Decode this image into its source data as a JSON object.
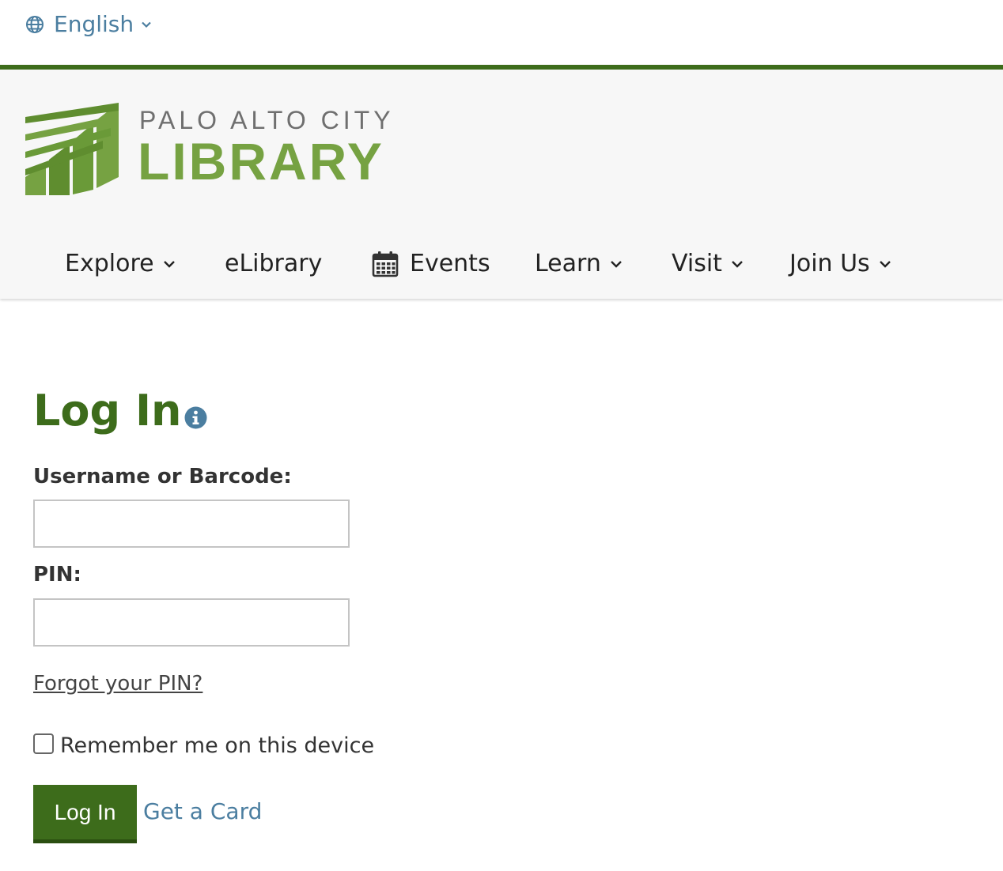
{
  "language": {
    "current": "English"
  },
  "logo": {
    "line1": "PALO ALTO CITY",
    "line2": "LIBRARY"
  },
  "nav": {
    "items": [
      {
        "label": "Explore",
        "has_dropdown": true
      },
      {
        "label": "eLibrary",
        "has_dropdown": false
      },
      {
        "label": "Events",
        "icon": "calendar-icon",
        "has_dropdown": false
      },
      {
        "label": "Learn",
        "has_dropdown": true
      },
      {
        "label": "Visit",
        "has_dropdown": true
      },
      {
        "label": "Join Us",
        "has_dropdown": true
      }
    ]
  },
  "login": {
    "title": "Log In",
    "username_label": "Username or Barcode:",
    "username_value": "",
    "pin_label": "PIN:",
    "pin_value": "",
    "forgot_pin": "Forgot your PIN?",
    "remember_label": "Remember me on this device",
    "remember_checked": false,
    "submit_label": "Log In",
    "get_card": "Get a Card"
  },
  "colors": {
    "brand_green": "#3d6c1b",
    "logo_green": "#76a242",
    "link_blue": "#4b7ea0",
    "header_bg": "#f7f7f7"
  }
}
